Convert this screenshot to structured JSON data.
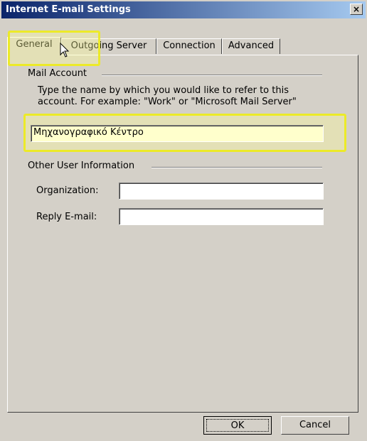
{
  "window": {
    "title": "Internet E-mail Settings",
    "close_glyph": "×"
  },
  "tabs": [
    {
      "label": "General",
      "active": true
    },
    {
      "label": "Outgoing Server",
      "active": false
    },
    {
      "label": "Connection",
      "active": false
    },
    {
      "label": "Advanced",
      "active": false
    }
  ],
  "mail_account": {
    "group_label": "Mail Account",
    "description_line1": "Type the name by which you would like to refer to this",
    "description_line2": "account.  For example: \"Work\" or \"Microsoft Mail Server\"",
    "account_name_value": "Μηχανογραφικό Κέντρο"
  },
  "user_info": {
    "group_label": "Other User Information",
    "organization_label": "Organization:",
    "organization_value": "",
    "reply_email_label": "Reply E-mail:",
    "reply_email_value": ""
  },
  "buttons": {
    "ok": "OK",
    "cancel": "Cancel"
  },
  "colors": {
    "title_start": "#0a246a",
    "title_end": "#a6caf0",
    "face": "#d4d0c8",
    "highlight": "#ecea28"
  },
  "icons": {
    "close": "close-icon",
    "pointer": "mouse-pointer-icon"
  }
}
